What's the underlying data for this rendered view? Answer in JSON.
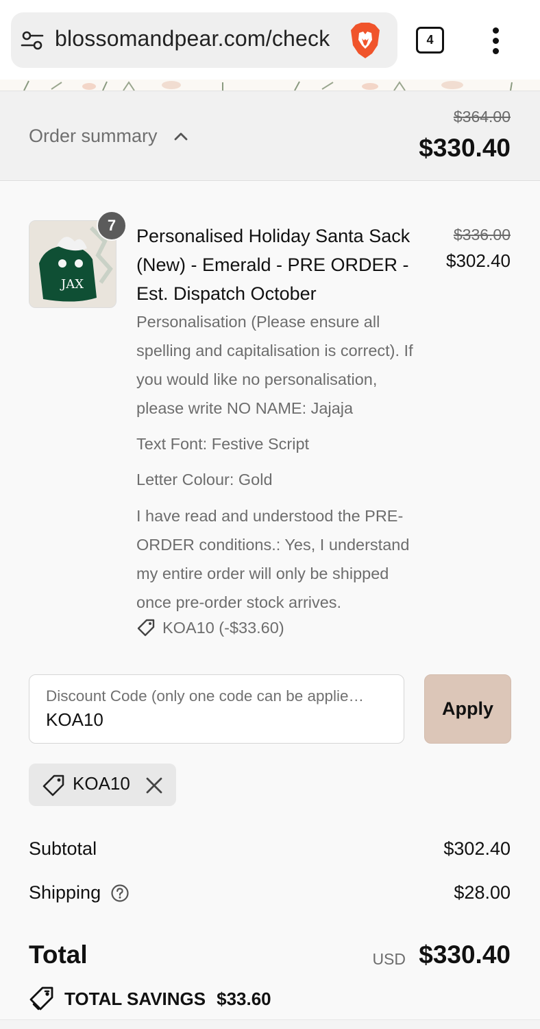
{
  "browser": {
    "url": "blossomandpear.com/check",
    "tab_count": "4"
  },
  "summary": {
    "toggle_label": "Order summary",
    "original_total": "$364.00",
    "total": "$330.40"
  },
  "line_item": {
    "quantity": "7",
    "title": "Personalised Holiday Santa Sack (New) - Emerald - PRE ORDER - Est. Dispatch October",
    "original_price": "$336.00",
    "price": "$302.40",
    "thumbnail_text": "JAX",
    "properties": [
      "Personalisation (Please ensure all spelling and capitalisation is correct). If you would like no personalisation, please write NO NAME: Jajaja",
      "Text Font: Festive Script",
      "Letter Colour: Gold",
      "I have read and understood the PRE-ORDER conditions.: Yes, I understand my entire order will only be shipped once pre-order stock arrives."
    ],
    "discount": "KOA10 (-$33.60)"
  },
  "discount_form": {
    "label": "Discount Code (only one code can be applie…",
    "value": "KOA10",
    "apply_label": "Apply",
    "applied_chip": "KOA10"
  },
  "totals": {
    "subtotal_label": "Subtotal",
    "subtotal_value": "$302.40",
    "shipping_label": "Shipping",
    "shipping_value": "$28.00",
    "total_label": "Total",
    "currency": "USD",
    "total_value": "$330.40",
    "savings_label": "TOTAL SAVINGS",
    "savings_value": "$33.60"
  },
  "colors": {
    "apply_button": "#dcc6b8",
    "summary_bar": "#f1f1f1",
    "product_green": "#0f4f34"
  }
}
